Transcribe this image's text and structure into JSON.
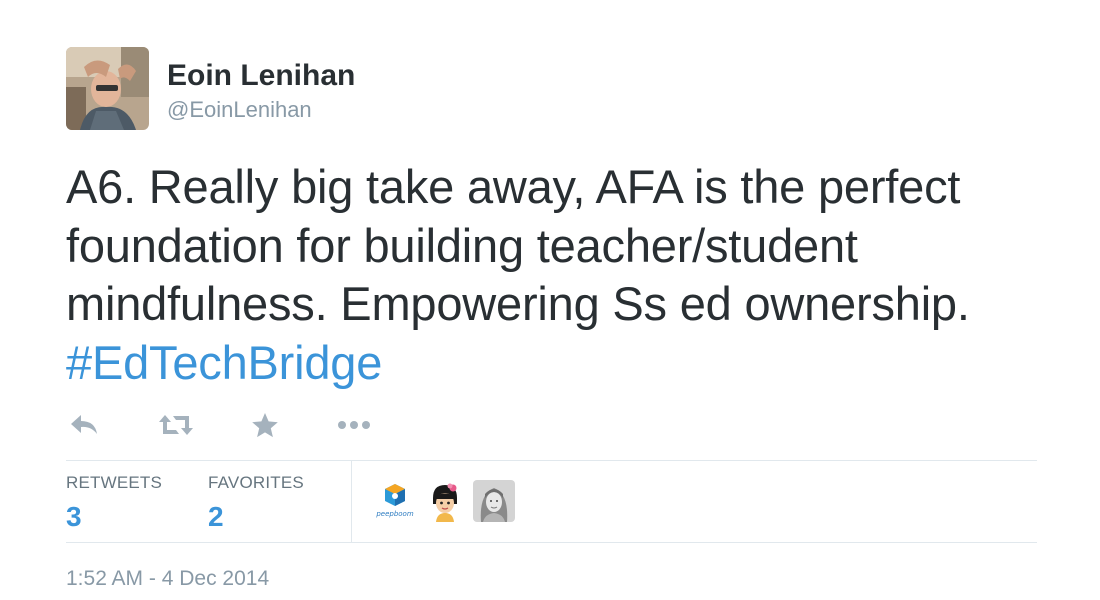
{
  "author": {
    "display_name": "Eoin Lenihan",
    "handle": "@EoinLenihan",
    "avatar_icon": "profile-photo"
  },
  "tweet": {
    "lines": [
      "A6. Really big take away, AFA is the perfect",
      "foundation for building teacher/student",
      "mindfulness. Empowering Ss ed ownership."
    ],
    "hashtag": "#EdTechBridge"
  },
  "actions": [
    {
      "name": "reply",
      "icon": "reply-icon"
    },
    {
      "name": "retweet",
      "icon": "retweet-icon"
    },
    {
      "name": "favorite",
      "icon": "star-icon"
    },
    {
      "name": "more",
      "icon": "more-icon"
    }
  ],
  "stats": {
    "retweets_label": "RETWEETS",
    "retweets_count": "3",
    "favorites_label": "FAVORITES",
    "favorites_count": "2"
  },
  "favoriters": [
    {
      "icon": "peepboom-logo-avatar",
      "logo_text": "peepboom"
    },
    {
      "icon": "cartoon-girl-avatar"
    },
    {
      "icon": "woman-photo-avatar"
    }
  ],
  "timestamp": "1:52 AM - 4 Dec 2014",
  "colors": {
    "link": "#3b94d9",
    "text": "#292f33",
    "muted": "#8899a6",
    "action_icon": "#a5b2bd",
    "divider": "#e1e8ed"
  }
}
